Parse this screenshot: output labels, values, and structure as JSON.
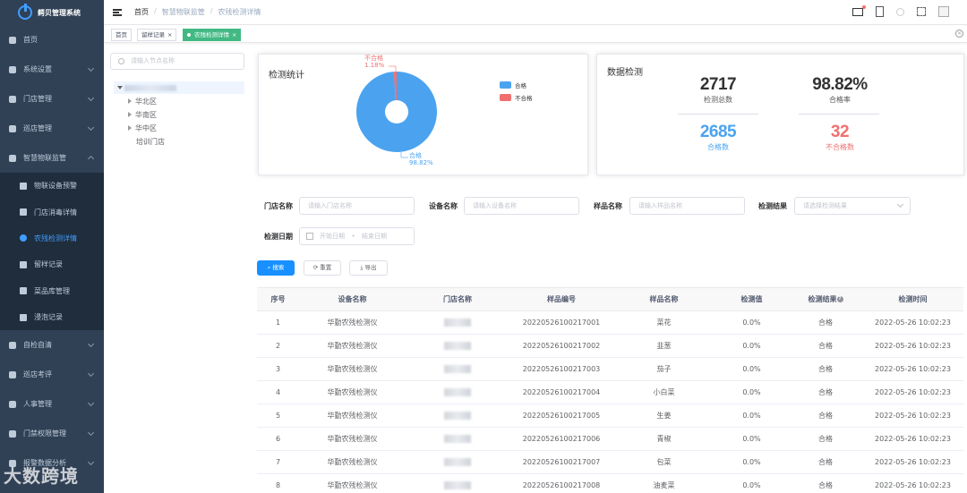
{
  "app": {
    "title": "鳄贝管理系统"
  },
  "sidebar": {
    "items": [
      {
        "label": "首页",
        "icon": "dashboard-icon"
      },
      {
        "label": "系统设置",
        "icon": "user-icon",
        "expandable": true
      },
      {
        "label": "门店管理",
        "icon": "store-icon",
        "expandable": true
      },
      {
        "label": "巡店管理",
        "icon": "grid-icon",
        "expandable": true
      },
      {
        "label": "智慧物联监管",
        "icon": "gear-icon",
        "expandable": true,
        "open": true
      }
    ],
    "submenu": [
      {
        "label": "物联设备预警",
        "icon": "bar-icon"
      },
      {
        "label": "门店消毒详情",
        "icon": "doc-icon"
      },
      {
        "label": "农残检测详情",
        "icon": "circle-icon",
        "active": true
      },
      {
        "label": "留样记录",
        "icon": "doc-icon"
      },
      {
        "label": "菜品库管理",
        "icon": "box-icon"
      },
      {
        "label": "浸泡记录",
        "icon": "doc-icon"
      }
    ],
    "items_after": [
      {
        "label": "自检自清",
        "icon": "check-icon",
        "expandable": true
      },
      {
        "label": "巡店考评",
        "icon": "list-icon",
        "expandable": true
      },
      {
        "label": "人事管理",
        "icon": "people-icon",
        "expandable": true
      },
      {
        "label": "门禁权限管理",
        "icon": "lock-icon",
        "expandable": true
      },
      {
        "label": "报警数据分析",
        "icon": "chart-icon",
        "expandable": true
      }
    ],
    "watermark": "大数跨境"
  },
  "breadcrumb": [
    "首页",
    "智慧物联监管",
    "农残检测详情"
  ],
  "tags": [
    {
      "label": "首页"
    },
    {
      "label": "留样记录",
      "closable": true
    },
    {
      "label": "农残检测详情",
      "closable": true,
      "active": true
    }
  ],
  "tree": {
    "search_placeholder": "请输入节点名称",
    "nodes": [
      "华北区",
      "华南区",
      "华中区",
      "培训门店"
    ]
  },
  "stats_card": {
    "title": "检测统计",
    "pie": {
      "slices": [
        {
          "name": "合格",
          "percent": 98.82,
          "color": "#4ba3f0"
        },
        {
          "name": "不合格",
          "percent": 1.18,
          "color": "#f07070"
        }
      ],
      "pass_label": "合格",
      "pass_pct": "98.82%",
      "fail_label": "不合格",
      "fail_pct": "1.18%"
    },
    "legend": [
      "合格",
      "不合格"
    ]
  },
  "data_card": {
    "title": "数据检测",
    "total": {
      "value": "2717",
      "label": "检测总数"
    },
    "rate": {
      "value": "98.82%",
      "label": "合格率"
    },
    "pass": {
      "value": "2685",
      "label": "合格数"
    },
    "fail": {
      "value": "32",
      "label": "不合格数"
    }
  },
  "filters": {
    "store_label": "门店名称",
    "store_placeholder": "请输入门店名称",
    "device_label": "设备名称",
    "device_placeholder": "请输入设备名称",
    "sample_label": "样品名称",
    "sample_placeholder": "请输入样品名称",
    "result_label": "检测结果",
    "result_placeholder": "请选择检测结果",
    "date_label": "检测日期",
    "date_start": "开始日期",
    "date_sep": "-",
    "date_end": "结束日期"
  },
  "buttons": {
    "search": "搜索",
    "reset": "重置",
    "export": "导出"
  },
  "table": {
    "headers": [
      "序号",
      "设备名称",
      "门店名称",
      "样品编号",
      "样品名称",
      "检测值",
      "检测结果",
      "检测时间"
    ],
    "rows": [
      [
        "1",
        "华勤农残检测仪",
        "",
        "20220526100217001",
        "菜花",
        "0.0%",
        "合格",
        "2022-05-26 10:02:23"
      ],
      [
        "2",
        "华勤农残检测仪",
        "",
        "20220526100217002",
        "韭葱",
        "0.0%",
        "合格",
        "2022-05-26 10:02:23"
      ],
      [
        "3",
        "华勤农残检测仪",
        "",
        "20220526100217003",
        "茄子",
        "0.0%",
        "合格",
        "2022-05-26 10:02:23"
      ],
      [
        "4",
        "华勤农残检测仪",
        "",
        "20220526100217004",
        "小白菜",
        "0.0%",
        "合格",
        "2022-05-26 10:02:23"
      ],
      [
        "5",
        "华勤农残检测仪",
        "",
        "20220526100217005",
        "生姜",
        "0.0%",
        "合格",
        "2022-05-26 10:02:23"
      ],
      [
        "6",
        "华勤农残检测仪",
        "",
        "20220526100217006",
        "青椒",
        "0.0%",
        "合格",
        "2022-05-26 10:02:23"
      ],
      [
        "7",
        "华勤农残检测仪",
        "",
        "20220526100217007",
        "包菜",
        "0.0%",
        "合格",
        "2022-05-26 10:02:23"
      ],
      [
        "8",
        "华勤农残检测仪",
        "",
        "20220526100217008",
        "油麦菜",
        "0.0%",
        "合格",
        "2022-05-26 10:02:23"
      ]
    ]
  },
  "colors": {
    "sidebar_bg": "#304156",
    "accent": "#409eff",
    "tag_active": "#42b983",
    "pass_blue": "#4ba3f0",
    "fail_red": "#f07070"
  }
}
